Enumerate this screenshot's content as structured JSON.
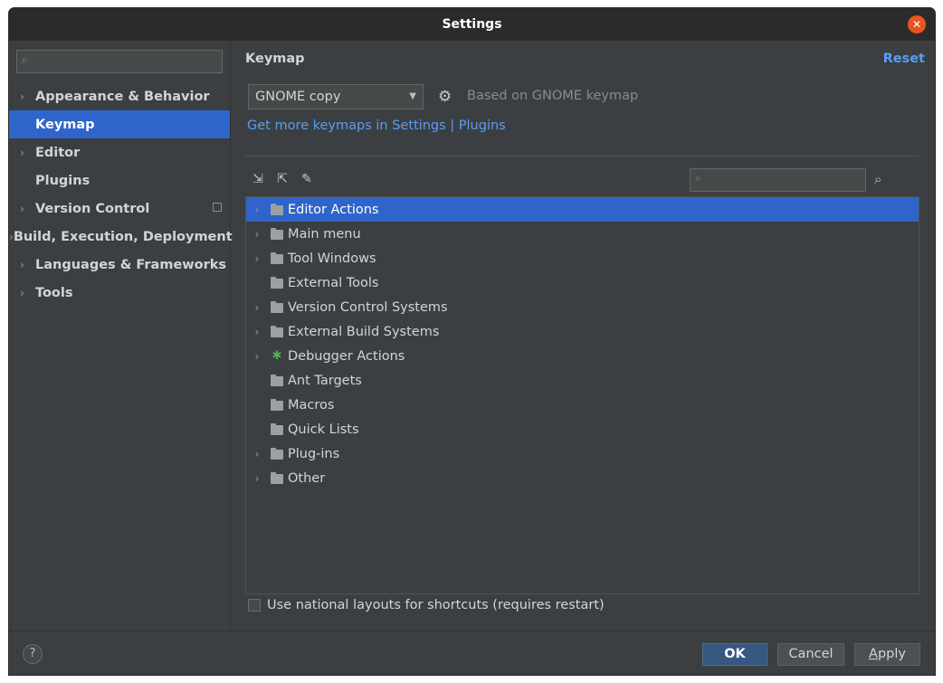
{
  "window": {
    "title": "Settings"
  },
  "sidebar": {
    "search_placeholder": "",
    "items": [
      {
        "label": "Appearance & Behavior",
        "expandable": true,
        "active": false
      },
      {
        "label": "Keymap",
        "expandable": false,
        "active": true
      },
      {
        "label": "Editor",
        "expandable": true,
        "active": false
      },
      {
        "label": "Plugins",
        "expandable": false,
        "active": false
      },
      {
        "label": "Version Control",
        "expandable": true,
        "active": false
      },
      {
        "label": "Build, Execution, Deployment",
        "expandable": true,
        "active": false
      },
      {
        "label": "Languages & Frameworks",
        "expandable": true,
        "active": false
      },
      {
        "label": "Tools",
        "expandable": true,
        "active": false
      }
    ]
  },
  "main": {
    "title": "Keymap",
    "reset_label": "Reset",
    "keymap_value": "GNOME copy",
    "based_on": "Based on GNOME keymap",
    "more_link": "Get more keymaps in Settings | Plugins",
    "tree": [
      {
        "label": "Editor Actions",
        "expandable": true,
        "selected": true
      },
      {
        "label": "Main menu",
        "expandable": true,
        "selected": false
      },
      {
        "label": "Tool Windows",
        "expandable": true,
        "selected": false
      },
      {
        "label": "External Tools",
        "expandable": false,
        "selected": false
      },
      {
        "label": "Version Control Systems",
        "expandable": true,
        "selected": false
      },
      {
        "label": "External Build Systems",
        "expandable": true,
        "selected": false
      },
      {
        "label": "Debugger Actions",
        "expandable": true,
        "selected": false
      },
      {
        "label": "Ant Targets",
        "expandable": false,
        "selected": false
      },
      {
        "label": "Macros",
        "expandable": false,
        "selected": false
      },
      {
        "label": "Quick Lists",
        "expandable": false,
        "selected": false
      },
      {
        "label": "Plug-ins",
        "expandable": true,
        "selected": false
      },
      {
        "label": "Other",
        "expandable": true,
        "selected": false
      }
    ],
    "national_layouts_label": "Use national layouts for shortcuts (requires restart)"
  },
  "footer": {
    "help": "?",
    "ok": "OK",
    "cancel": "Cancel",
    "apply_first": "A",
    "apply_rest": "pply"
  },
  "colors": {
    "accent": "#2f65ca",
    "link": "#589df6",
    "ok_button": "#365880"
  }
}
